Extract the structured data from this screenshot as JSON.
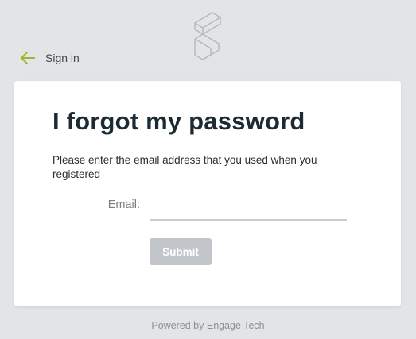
{
  "header": {
    "logo_icon": "stacked-s-logo-icon",
    "back_icon": "arrow-left-icon",
    "back_label": "Sign in"
  },
  "card": {
    "title": "I forgot my password",
    "instructions": "Please enter the email address that you used when you registered",
    "email_label": "Email:",
    "email_value": "",
    "email_placeholder": "",
    "submit_label": "Submit"
  },
  "footer": {
    "text": "Powered by Engage Tech"
  },
  "colors": {
    "background": "#e3e4e6",
    "accent": "#9bb832",
    "title": "#1c2a33",
    "button_disabled": "#c2c6ca"
  }
}
